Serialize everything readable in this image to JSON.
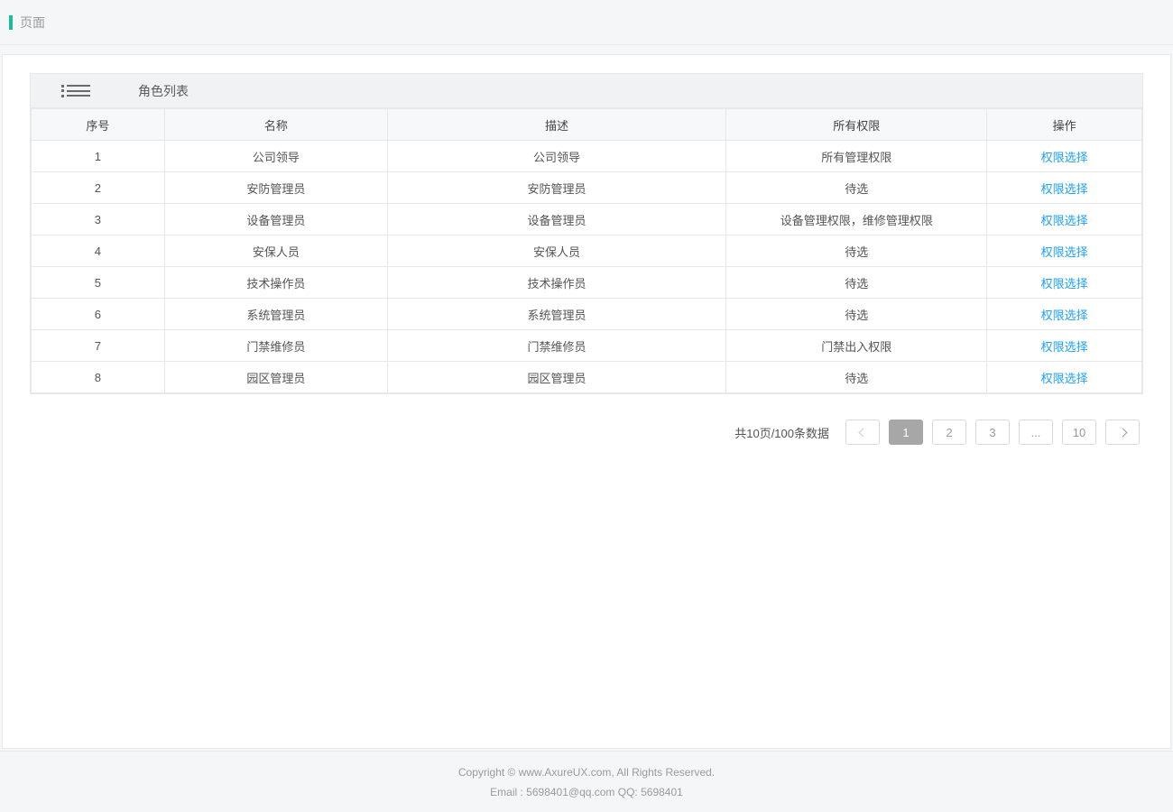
{
  "header": {
    "breadcrumb": "页面"
  },
  "panel": {
    "title": "角色列表"
  },
  "table": {
    "columns": {
      "seq": "序号",
      "name": "名称",
      "desc": "描述",
      "perm": "所有权限",
      "op": "操作"
    },
    "action_label": "权限选择",
    "rows": [
      {
        "seq": "1",
        "name": "公司领导",
        "desc": "公司领导",
        "perm": "所有管理权限"
      },
      {
        "seq": "2",
        "name": "安防管理员",
        "desc": "安防管理员",
        "perm": "待选"
      },
      {
        "seq": "3",
        "name": "设备管理员",
        "desc": "设备管理员",
        "perm": "设备管理权限，维修管理权限"
      },
      {
        "seq": "4",
        "name": "安保人员",
        "desc": "安保人员",
        "perm": "待选"
      },
      {
        "seq": "5",
        "name": "技术操作员",
        "desc": "技术操作员",
        "perm": "待选"
      },
      {
        "seq": "6",
        "name": "系统管理员",
        "desc": "系统管理员",
        "perm": "待选"
      },
      {
        "seq": "7",
        "name": "门禁维修员",
        "desc": "门禁维修员",
        "perm": "门禁出入权限"
      },
      {
        "seq": "8",
        "name": "园区管理员",
        "desc": "园区管理员",
        "perm": "待选"
      }
    ]
  },
  "pagination": {
    "info": "共10页/100条数据",
    "pages": [
      "1",
      "2",
      "3",
      "...",
      "10"
    ],
    "active_index": 0
  },
  "footer": {
    "line1": "Copyright © www.AxureUX.com, All Rights Reserved.",
    "line2": "Email : 5698401@qq.com  QQ: 5698401"
  }
}
